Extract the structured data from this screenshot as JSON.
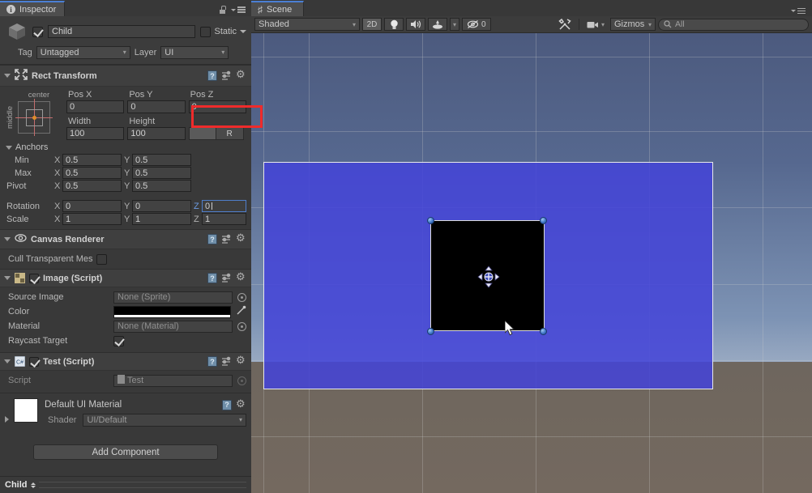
{
  "inspector": {
    "tab_label": "Inspector",
    "tab_icon": "info-icon",
    "lock_icon": "lock-icon",
    "menu_icon": "hamburger-menu-icon",
    "object": {
      "icon": "cube-icon",
      "enabled": true,
      "name": "Child",
      "static_label": "Static",
      "static_checked": false,
      "tag_label": "Tag",
      "tag_value": "Untagged",
      "layer_label": "Layer",
      "layer_value": "UI"
    },
    "rect_transform": {
      "title": "Rect Transform",
      "anchor_preset": {
        "horizontal": "center",
        "vertical": "middle"
      },
      "pos_x_label": "Pos X",
      "pos_y_label": "Pos Y",
      "pos_z_label": "Pos Z",
      "pos_x": "0",
      "pos_y": "0",
      "pos_z": "0",
      "width_label": "Width",
      "height_label": "Height",
      "width": "100",
      "height": "100",
      "blueprint_button": "",
      "rawedit_button": "R",
      "anchors_label": "Anchors",
      "min_label": "Min",
      "max_label": "Max",
      "pivot_label": "Pivot",
      "rotation_label": "Rotation",
      "scale_label": "Scale",
      "axis_x": "X",
      "axis_y": "Y",
      "axis_z": "Z",
      "min_x": "0.5",
      "min_y": "0.5",
      "max_x": "0.5",
      "max_y": "0.5",
      "pivot_x": "0.5",
      "pivot_y": "0.5",
      "rot_x": "0",
      "rot_y": "0",
      "rot_z": "0",
      "scale_x": "1",
      "scale_y": "1",
      "scale_z": "1"
    },
    "canvas_renderer": {
      "title": "Canvas Renderer",
      "icon": "eye-icon",
      "cull_label": "Cull Transparent Mes",
      "cull_checked": false
    },
    "image_component": {
      "title": "Image (Script)",
      "enabled": true,
      "icon": "image-script-icon",
      "source_image_label": "Source Image",
      "source_image_value": "None (Sprite)",
      "color_label": "Color",
      "color_value": "#000000",
      "material_label": "Material",
      "material_value": "None (Material)",
      "raycast_label": "Raycast Target",
      "raycast_checked": true,
      "eyedropper_icon": "eyedropper-icon"
    },
    "test_component": {
      "title": "Test (Script)",
      "enabled": true,
      "icon": "csharp-script-icon",
      "script_label": "Script",
      "script_value": "Test"
    },
    "material_block": {
      "name": "Default UI Material",
      "shader_label": "Shader",
      "shader_value": "UI/Default",
      "swatch_color": "#ffffff"
    },
    "add_component_label": "Add Component",
    "status_bar": {
      "name": "Child"
    },
    "highlight_color": "#ef2b2b"
  },
  "scene": {
    "tab_label": "Scene",
    "tab_icon": "grid-hash-icon",
    "menu_icon": "hamburger-menu-icon",
    "toolbar": {
      "shading_mode": "Shaded",
      "mode_2d": "2D",
      "light_icon": "lightbulb-icon",
      "audio_icon": "speaker-icon",
      "fx_icon": "effects-icon",
      "fx_dropdown_icon": "chevron-down-icon",
      "visibility_icon": "eye-off-icon",
      "visibility_count": "0",
      "tools_icon": "tools-icon",
      "camera_icon": "camera-icon",
      "gizmos_label": "Gizmos",
      "search_icon": "search-icon",
      "search_placeholder": "All"
    },
    "viewport": {
      "sky_top_color": "#4c5a7e",
      "ground_color": "#6e665e",
      "canvas_color": "#4444d8",
      "image_color": "#000000",
      "selection_handle_color": "#3f76c8",
      "gizmo_icon": "move-gizmo-icon",
      "cursor_icon": "arrow-cursor-icon"
    }
  }
}
